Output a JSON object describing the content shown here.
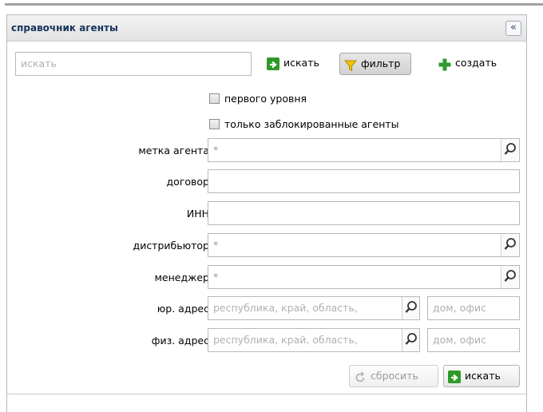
{
  "panel": {
    "title": "справочник агенты",
    "collapse_glyph": "«"
  },
  "toolbar": {
    "search_placeholder": "искать",
    "search_button": "искать",
    "filter_button": "фильтр",
    "create_button": "создать"
  },
  "filters": {
    "first_level_label": "первого уровня",
    "blocked_only_label": "только заблокированные агенты",
    "fields": {
      "agent_tag": {
        "label": "метка агента",
        "value": "*"
      },
      "contract": {
        "label": "договор",
        "value": ""
      },
      "inn": {
        "label": "ИНН",
        "value": ""
      },
      "distributor": {
        "label": "дистрибьютор",
        "value": "*"
      },
      "manager": {
        "label": "менеджер",
        "value": "*"
      },
      "legal_address": {
        "label": "юр. адрес",
        "region_placeholder": "республика, край, область,",
        "house_placeholder": "дом, офис"
      },
      "physical_address": {
        "label": "физ. адрес",
        "region_placeholder": "республика, край, область,",
        "house_placeholder": "дом, офис"
      }
    },
    "reset_button": "сбросить",
    "search_button": "искать"
  },
  "colors": {
    "title": "#15345a",
    "accent_green": "#2f9a2a",
    "filter_yellow": "#f2c400"
  }
}
